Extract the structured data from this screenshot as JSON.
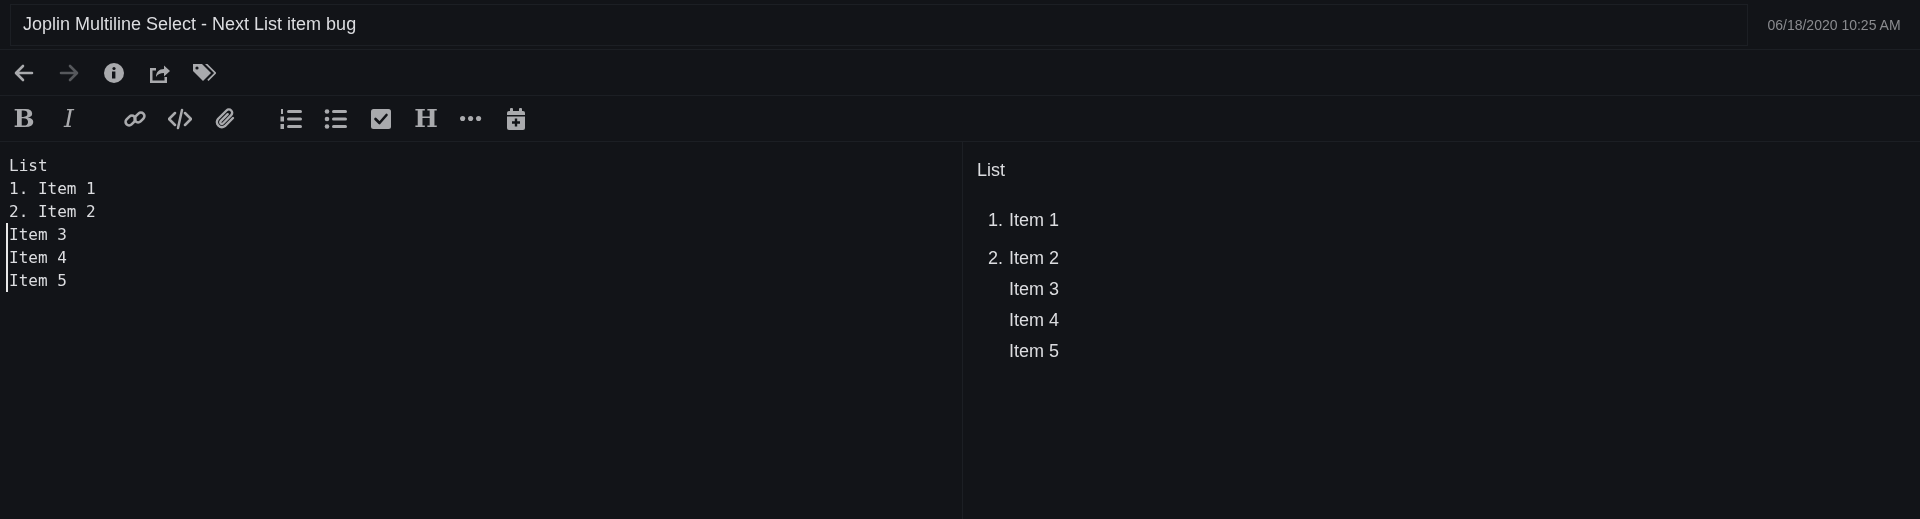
{
  "note": {
    "title": "Joplin Multiline Select - Next List item bug",
    "date": "06/18/2020 10:25 AM"
  },
  "nav_toolbar": [
    {
      "kind": "back",
      "disabled": false
    },
    {
      "kind": "forward",
      "disabled": true
    },
    {
      "kind": "info",
      "disabled": false
    },
    {
      "kind": "share",
      "disabled": false
    },
    {
      "kind": "tags",
      "disabled": false
    }
  ],
  "format_toolbar": [
    [
      {
        "kind": "bold",
        "glyph": "B"
      },
      {
        "kind": "italic",
        "glyph": "I"
      }
    ],
    [
      {
        "kind": "link"
      },
      {
        "kind": "code"
      },
      {
        "kind": "attach"
      }
    ],
    [
      {
        "kind": "ordered-list"
      },
      {
        "kind": "bullet-list"
      },
      {
        "kind": "checkbox"
      },
      {
        "kind": "heading",
        "glyph": "H"
      },
      {
        "kind": "more"
      },
      {
        "kind": "calendar"
      }
    ]
  ],
  "editor": {
    "lines": [
      {
        "text": "List",
        "cursor": false
      },
      {
        "text": "1. Item 1",
        "cursor": false
      },
      {
        "text": "2. Item 2",
        "cursor": false
      },
      {
        "text": "Item 3",
        "cursor": true
      },
      {
        "text": "Item 4",
        "cursor": true
      },
      {
        "text": "Item 5",
        "cursor": true
      }
    ]
  },
  "preview": {
    "paragraph": "List",
    "list": [
      {
        "number": "1.",
        "lines": [
          "Item 1"
        ]
      },
      {
        "number": "2.",
        "lines": [
          "Item 2",
          "Item 3",
          "Item 4",
          "Item 5"
        ]
      }
    ]
  }
}
